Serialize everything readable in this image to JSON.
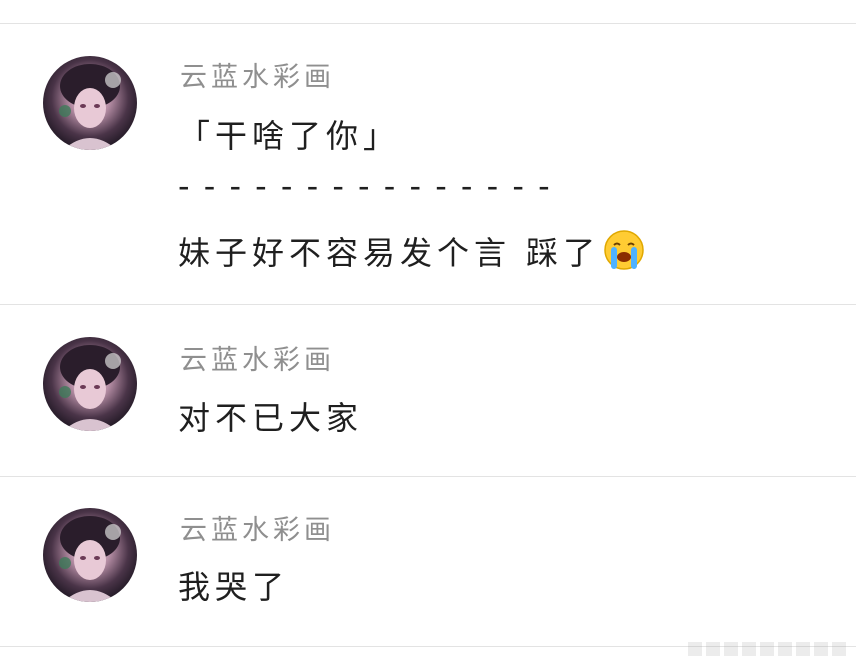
{
  "comments": [
    {
      "username": "云蓝水彩画",
      "lines": [
        "「干啥了你」",
        "- - - - - - - - - - - - - - -",
        "妹子好不容易发个言 踩了"
      ],
      "emoji": "crying-face-icon"
    },
    {
      "username": "云蓝水彩画",
      "lines": [
        "对不已大家"
      ]
    },
    {
      "username": "云蓝水彩画",
      "lines": [
        "我哭了"
      ]
    }
  ],
  "colors": {
    "username": "#8f8f8f",
    "text": "#1f1f1f",
    "divider": "#e3e3e3"
  }
}
